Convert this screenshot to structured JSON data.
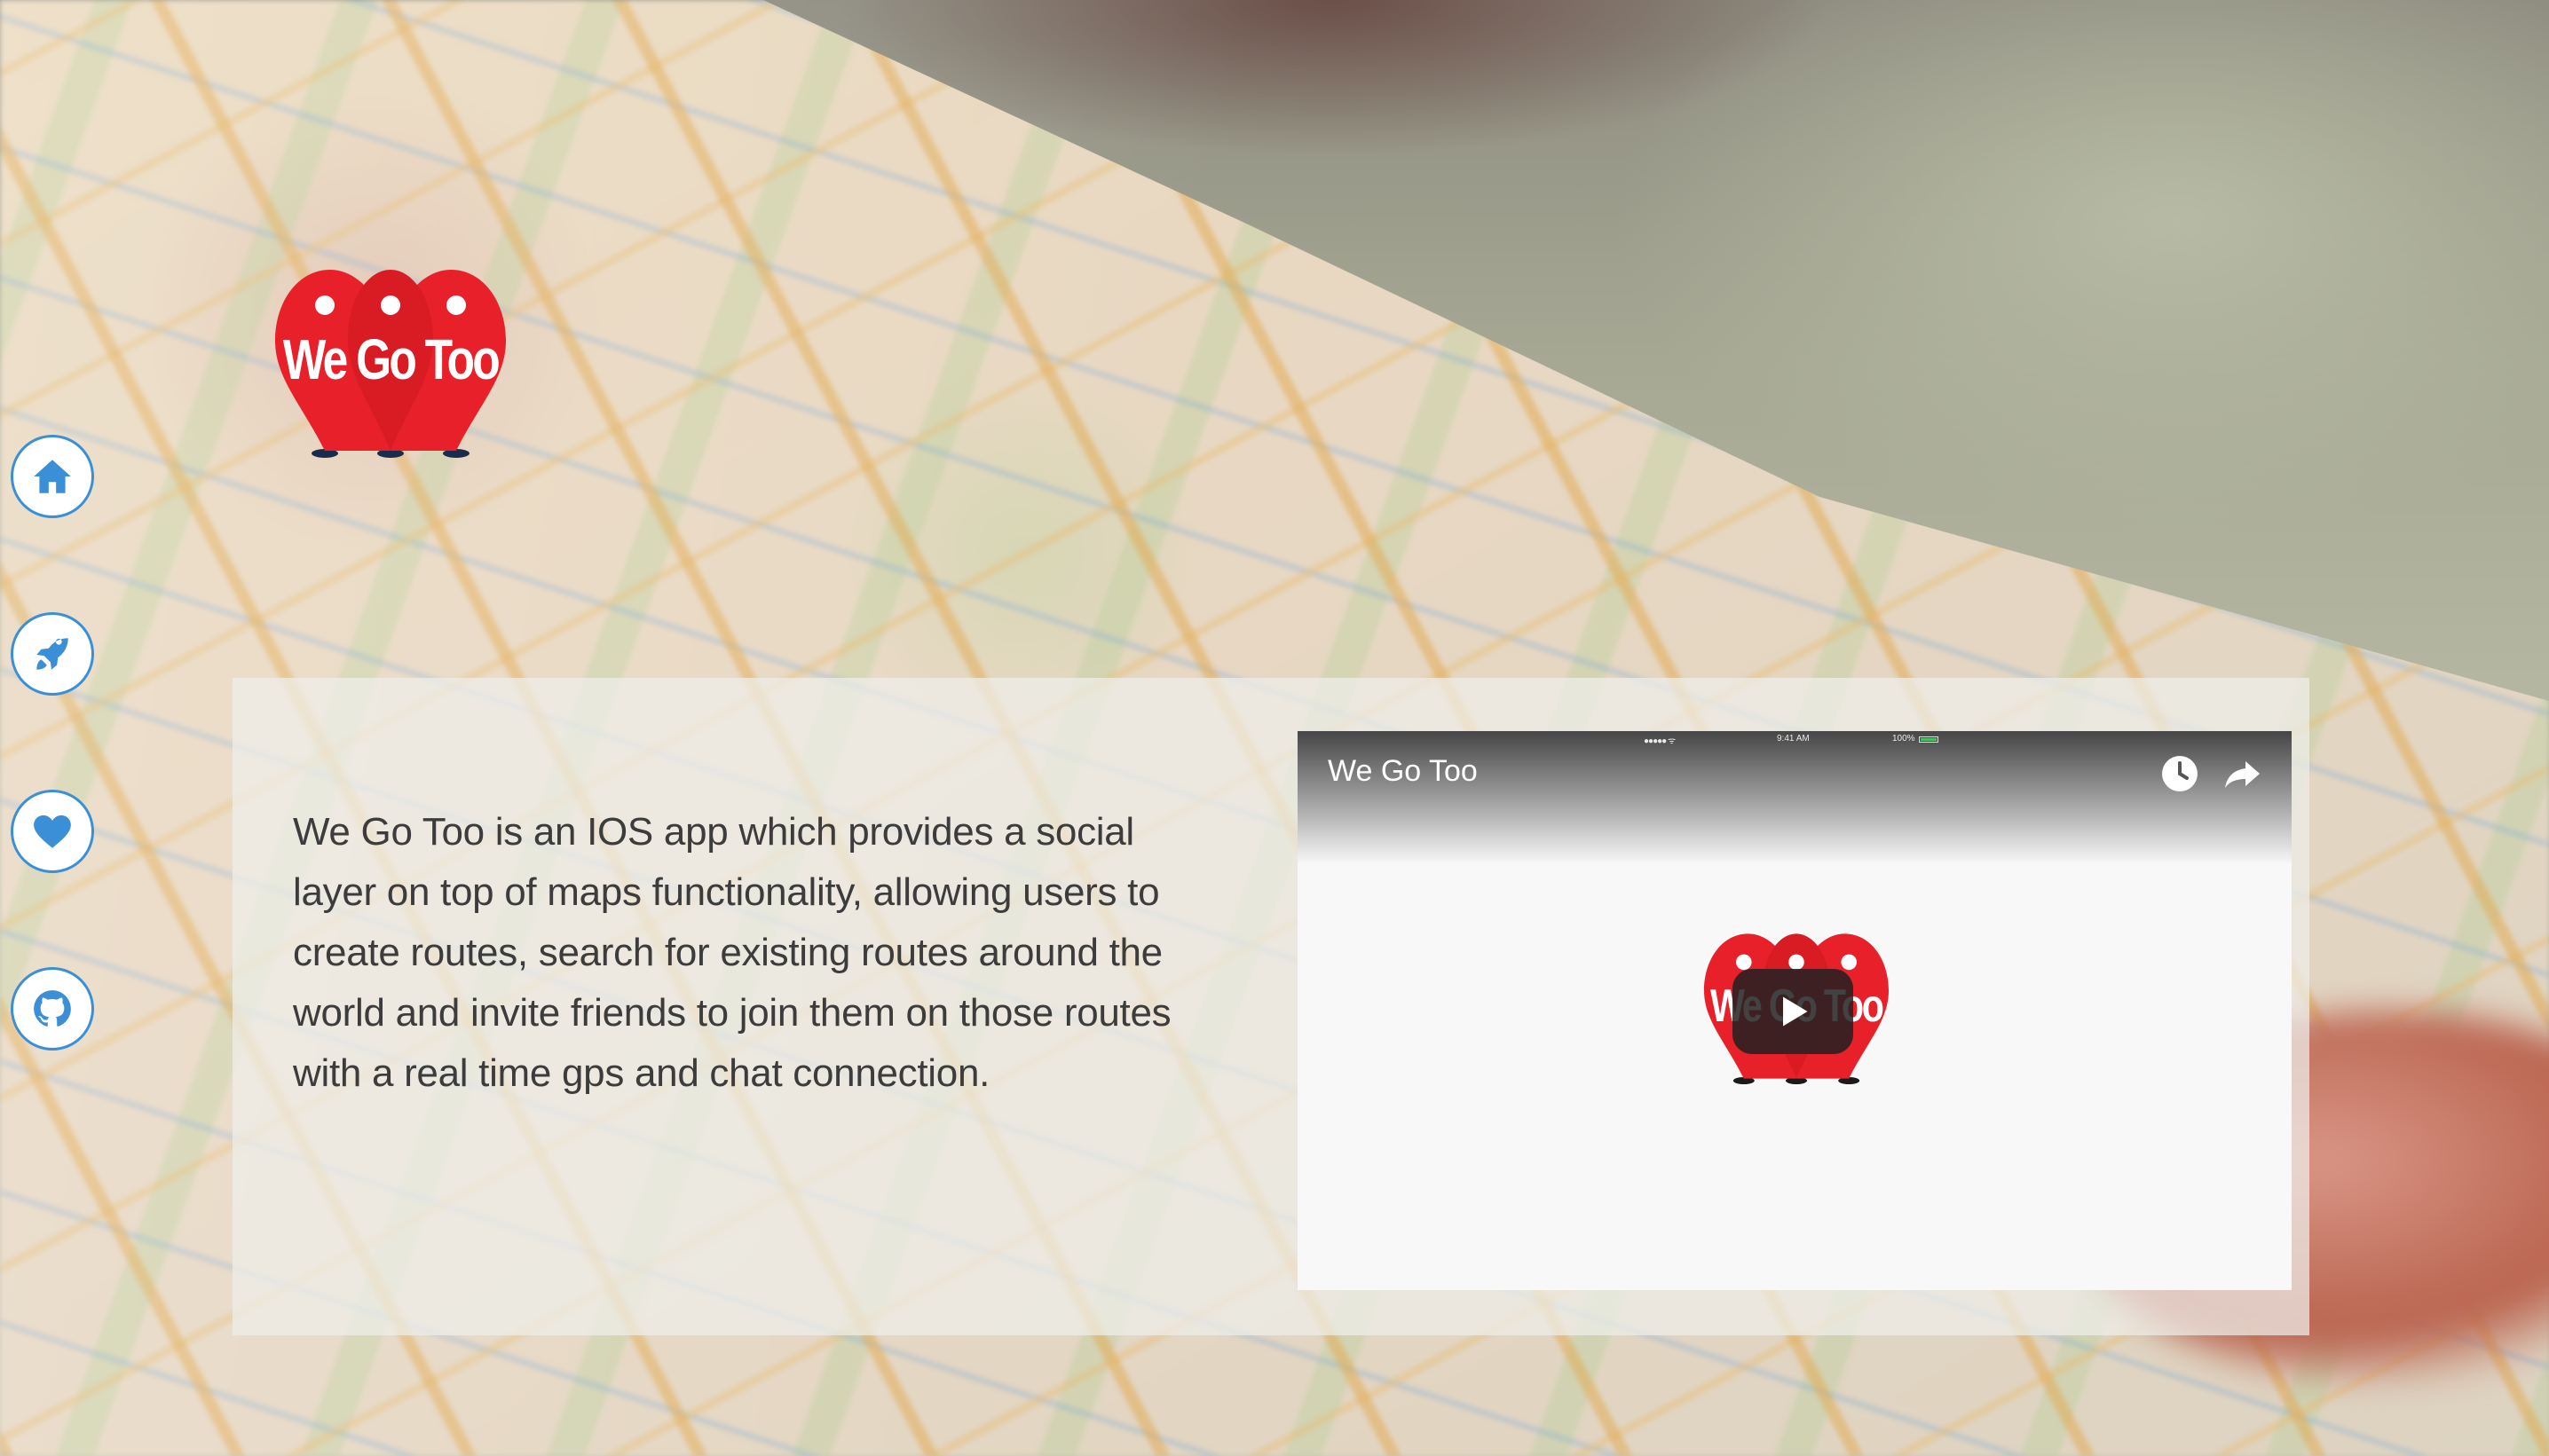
{
  "logo": {
    "text": "We Go Too",
    "icon": "we-go-too-pins-logo",
    "colors": {
      "pin": "#e8202a",
      "pin_shadow": "#1b2b4b",
      "text": "#ffffff"
    }
  },
  "sidenav": {
    "accent_color": "#3b8fd6",
    "items": [
      {
        "icon": "home-icon"
      },
      {
        "icon": "rocket-icon"
      },
      {
        "icon": "heart-icon"
      },
      {
        "icon": "github-icon"
      }
    ]
  },
  "main": {
    "description": "We Go Too is an IOS app which provides a social layer on top of maps functionality, allowing users to create routes, search for existing routes around the world and invite friends to join them on those routes with a real time gps and chat connection."
  },
  "video": {
    "title": "We Go Too",
    "watch_later_icon": "clock-icon",
    "share_icon": "share-arrow-icon",
    "play_icon": "play-icon",
    "status_bar": {
      "carrier": "●●●●● ᯤ",
      "time": "9:41 AM",
      "battery": "100%"
    }
  }
}
